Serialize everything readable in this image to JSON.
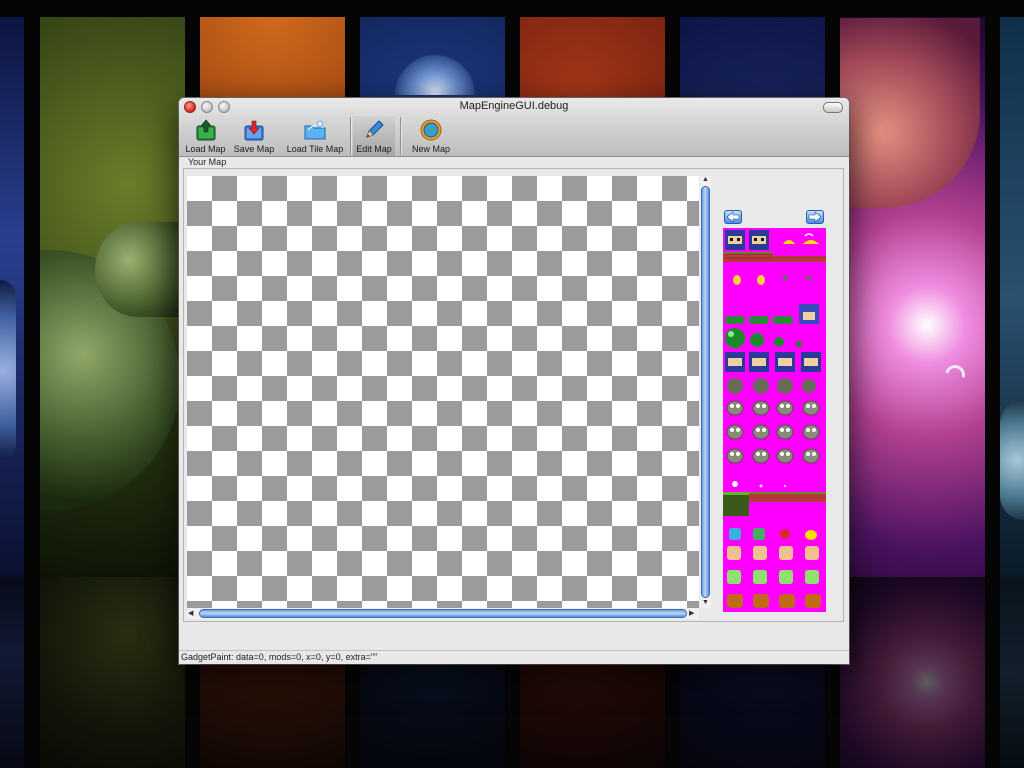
{
  "window": {
    "title": "MapEngineGUI.debug"
  },
  "toolbar": {
    "buttons": [
      {
        "label": "Load Map",
        "icon": "load-map-icon"
      },
      {
        "label": "Save Map",
        "icon": "save-map-icon"
      },
      {
        "label": "Load Tile Map",
        "icon": "load-tile-map-icon"
      },
      {
        "label": "Edit Map",
        "icon": "pencil-icon"
      },
      {
        "label": "New Map",
        "icon": "globe-gear-icon"
      }
    ]
  },
  "map_panel": {
    "label": "Your Map"
  },
  "tileset": {
    "background_color": "#ff00ff",
    "prev_icon": "arrow-left-icon",
    "next_icon": "arrow-right-icon"
  },
  "status_bar": {
    "text": "GadgetPaint: data=0, mods=0, x=0, y=0, extra=\"\""
  },
  "colors": {
    "accent_blue": "#4a8ae8",
    "checker_gray": "#9b9b9b"
  }
}
